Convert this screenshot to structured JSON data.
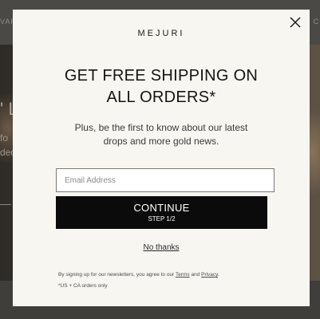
{
  "background": {
    "nav_left": "VAR",
    "nav_right": "C",
    "hero_big": "' L",
    "hero_line1": "fo",
    "hero_line2": "ded"
  },
  "modal": {
    "logo": "MEJURI",
    "headline_line1": "GET FREE SHIPPING ON",
    "headline_line2": "ALL ORDERS*",
    "subtext_line1": "Plus, be the first to know about our latest",
    "subtext_line2": "drops and more gold news.",
    "email_placeholder": "Email Address",
    "email_value": "",
    "continue_label": "CONTINUE",
    "continue_step": "STEP 1/2",
    "no_thanks": "No thanks",
    "legal_prefix": "By signing up for our newsletters, you agree to our ",
    "legal_terms": "Terms",
    "legal_and": " and ",
    "legal_privacy": "Privacy",
    "legal_suffix": ".",
    "legal_note": "*US + CA orders only",
    "close_icon": "close-icon"
  },
  "colors": {
    "overlay_bg": "#f7f6f1",
    "button_bg": "#0b0b0b",
    "text_dark": "#141414"
  }
}
